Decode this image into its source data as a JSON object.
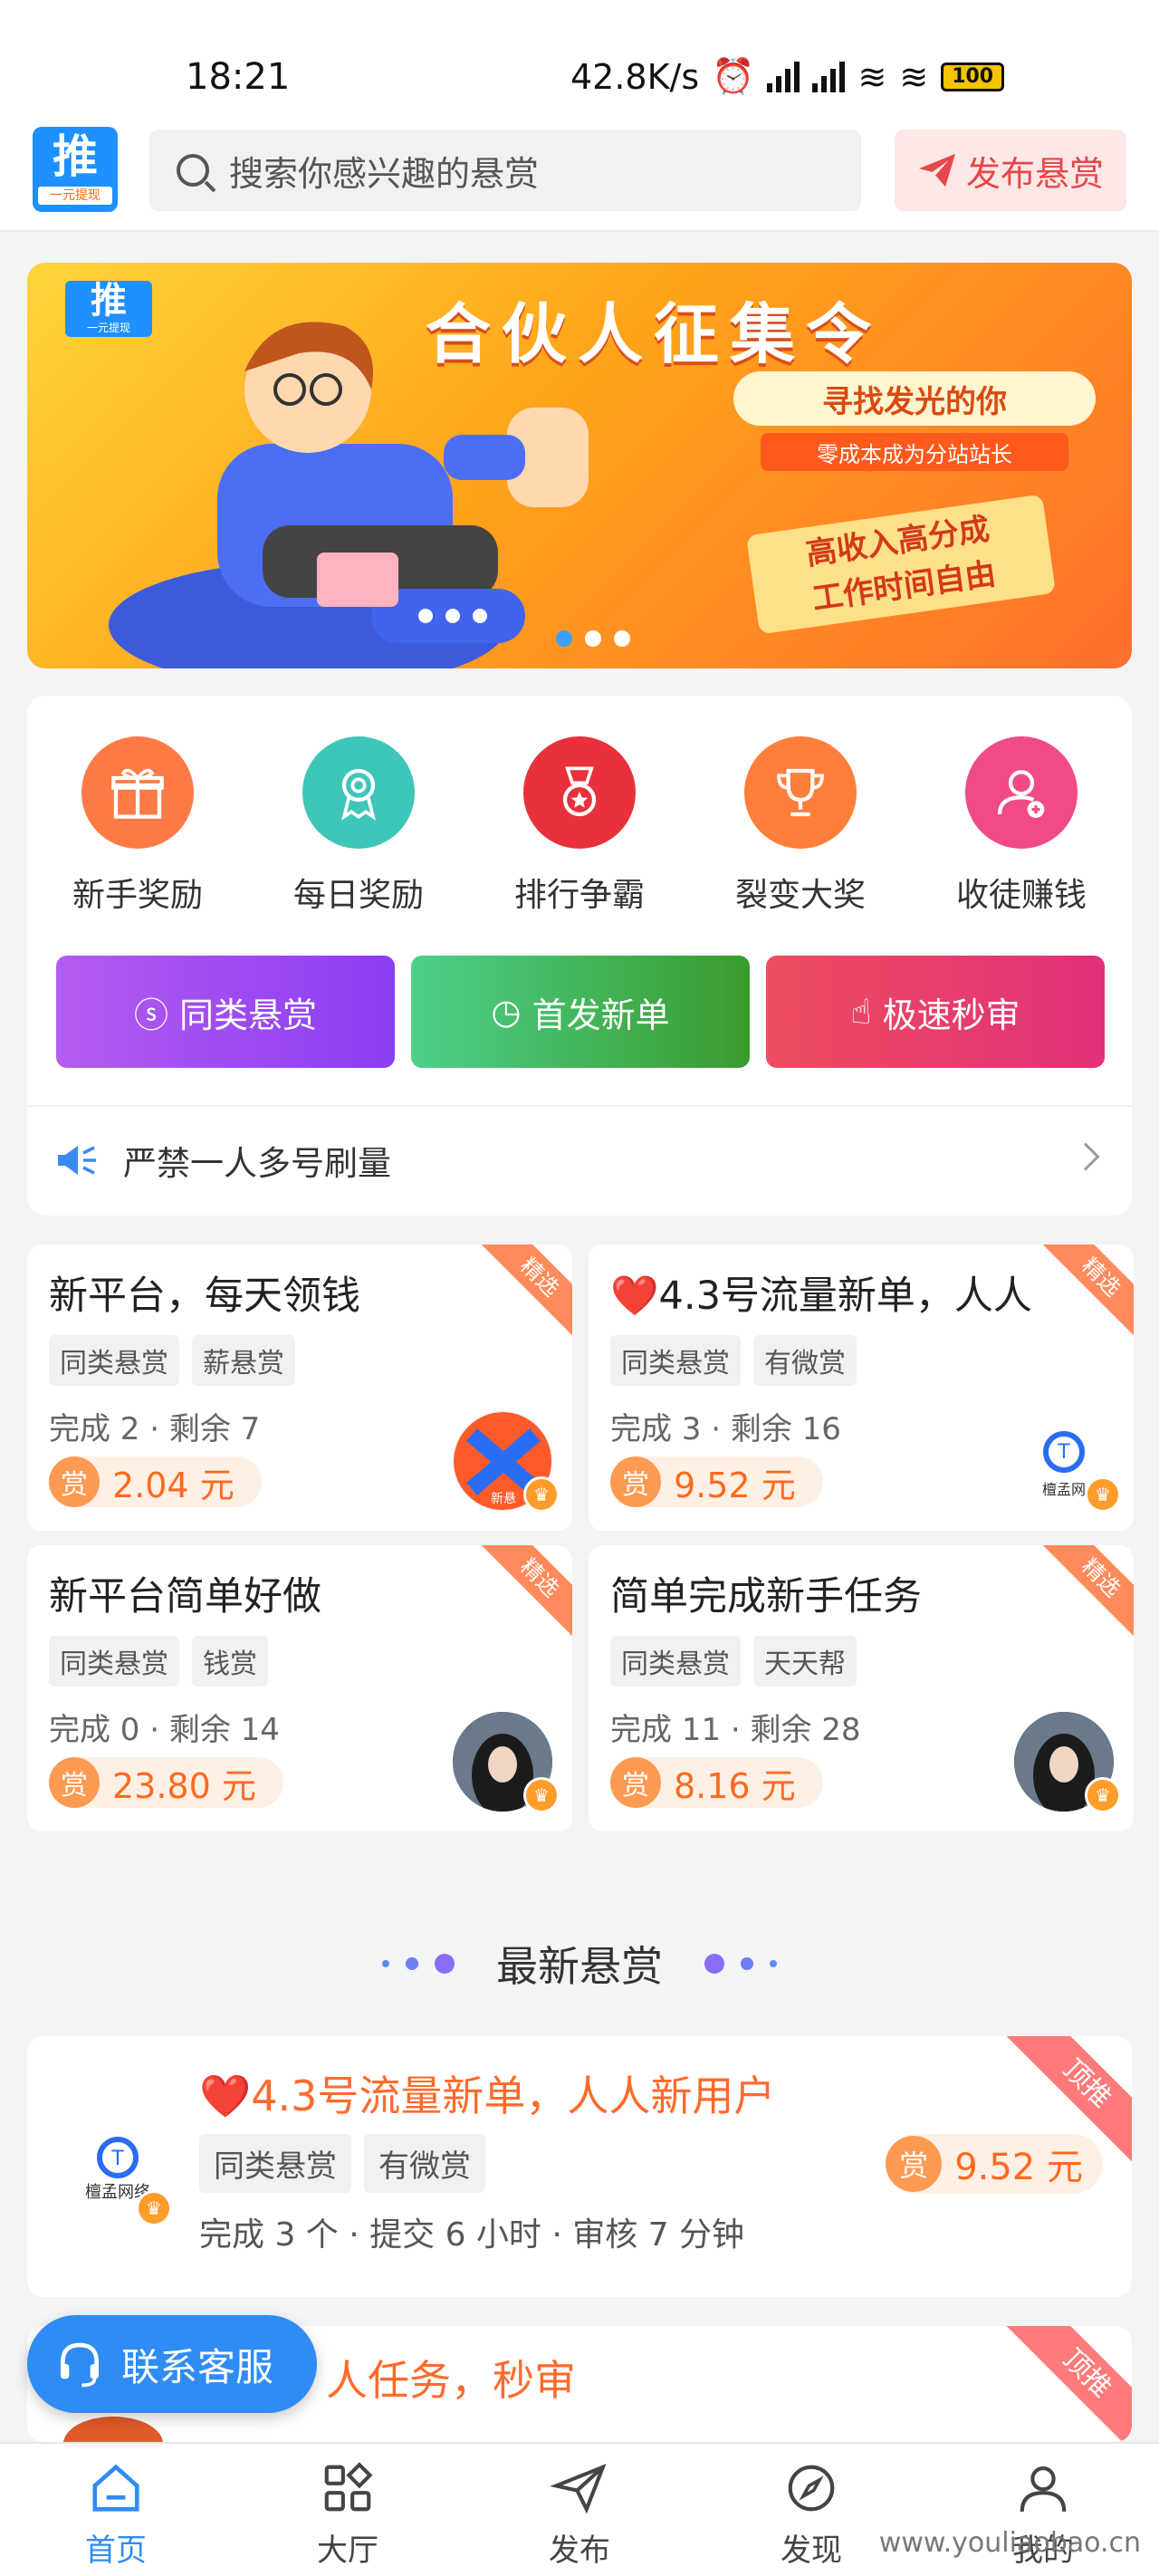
{
  "status_bar": {
    "time": "18:21",
    "speed": "42.8K/s",
    "battery": "100"
  },
  "header": {
    "logo_main": "推",
    "logo_sub": "一元提现",
    "search_placeholder": "搜索你感兴趣的悬赏",
    "publish_label": "发布悬赏"
  },
  "banner": {
    "logo_main": "推",
    "logo_sub": "一元提现",
    "title": "合伙人征集令",
    "line1": "寻找发光的你",
    "line2": "零成本成为分站站长",
    "line3a": "高收入高分成",
    "line3b": "工作时间自由",
    "active_dot": 0
  },
  "features": [
    {
      "label": "新手奖励",
      "icon": "gift-icon",
      "color": "#ff7a45"
    },
    {
      "label": "每日奖励",
      "icon": "medal-icon",
      "color": "#3ec6b8"
    },
    {
      "label": "排行争霸",
      "icon": "rank-badge-icon",
      "color": "#e8313a"
    },
    {
      "label": "裂变大奖",
      "icon": "trophy-icon",
      "color": "#ff7f3a"
    },
    {
      "label": "收徒赚钱",
      "icon": "add-user-icon",
      "color": "#f04b86"
    }
  ],
  "quick_buttons": [
    {
      "label": "同类悬赏",
      "icon": "bolt-icon"
    },
    {
      "label": "首发新单",
      "icon": "timer-icon"
    },
    {
      "label": "极速秒审",
      "icon": "thumb-icon"
    }
  ],
  "notice": {
    "text": "严禁一人多号刷量"
  },
  "task_cards": [
    {
      "title": "新平台，每天领钱",
      "badge": "精选",
      "tags": [
        "同类悬赏",
        "薪悬赏"
      ],
      "meta": "完成 2 · 剩余 7",
      "reward_mark": "赏",
      "reward": "2.04 元",
      "avatar_text": "新悬"
    },
    {
      "title": "❤️4.3号流量新单，人人",
      "badge": "精选",
      "tags": [
        "同类悬赏",
        "有微赏"
      ],
      "meta": "完成 3 · 剩余 16",
      "reward_mark": "赏",
      "reward": "9.52 元",
      "avatar_text": "檀孟网"
    },
    {
      "title": "新平台简单好做",
      "badge": "精选",
      "tags": [
        "同类悬赏",
        "钱赏"
      ],
      "meta": "完成 0 · 剩余 14",
      "reward_mark": "赏",
      "reward": "23.80 元",
      "avatar_text": ""
    },
    {
      "title": "简单完成新手任务",
      "badge": "精选",
      "tags": [
        "同类悬赏",
        "天天帮"
      ],
      "meta": "完成 11 · 剩余 28",
      "reward_mark": "赏",
      "reward": "8.16 元",
      "avatar_text": ""
    }
  ],
  "section": {
    "title": "最新悬赏"
  },
  "latest": [
    {
      "title": "❤️4.3号流量新单，人人新用户",
      "badge": "顶推",
      "tags": [
        "同类悬赏",
        "有微赏"
      ],
      "meta": "完成 3 个 · 提交 6 小时 · 审核 7 分钟",
      "reward_mark": "赏",
      "reward": "9.52 元",
      "avatar_text": "檀孟网络"
    },
    {
      "title": "人任务，秒审",
      "badge": "顶推"
    }
  ],
  "service": {
    "label": "联系客服"
  },
  "nav": [
    {
      "label": "首页",
      "icon": "home-icon",
      "active": true
    },
    {
      "label": "大厅",
      "icon": "grid-icon",
      "active": false
    },
    {
      "label": "发布",
      "icon": "send-icon",
      "active": false
    },
    {
      "label": "发现",
      "icon": "compass-icon",
      "active": false
    },
    {
      "label": "我的",
      "icon": "user-icon",
      "active": false
    }
  ],
  "watermark": "www.youliaobao.cn",
  "colors": {
    "accent": "#2f8cf5",
    "reward": "#ff6a1e",
    "btn1": "#a855f7",
    "btn2": "#39b54a",
    "btn3": "#e8314a"
  }
}
